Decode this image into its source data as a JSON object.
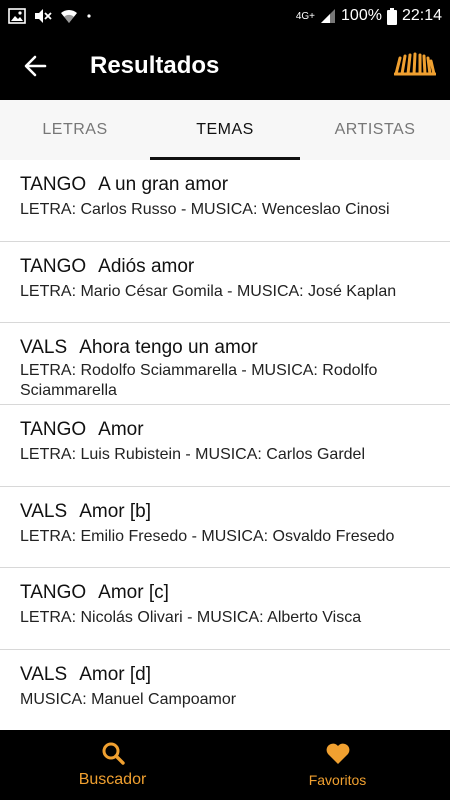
{
  "status_bar": {
    "network": "4G+",
    "battery": "100%",
    "time": "22:14"
  },
  "app_bar": {
    "title": "Resultados",
    "back_icon": "back-arrow-icon",
    "logo_icon": "bandoneon-logo-icon"
  },
  "tabs": [
    {
      "label": "LETRAS",
      "active": false
    },
    {
      "label": "TEMAS",
      "active": true
    },
    {
      "label": "ARTISTAS",
      "active": false
    }
  ],
  "results": [
    {
      "genre": "TANGO",
      "title": "A un gran amor",
      "credits": "LETRA: Carlos Russo - MUSICA: Wenceslao Cinosi"
    },
    {
      "genre": "TANGO",
      "title": "Adiós amor",
      "credits": "LETRA: Mario César Gomila - MUSICA: José Kaplan"
    },
    {
      "genre": "VALS",
      "title": "Ahora tengo un amor",
      "credits": "LETRA: Rodolfo Sciammarella - MUSICA: Rodolfo Sciammarella"
    },
    {
      "genre": "TANGO",
      "title": "Amor",
      "credits": "LETRA: Luis Rubistein - MUSICA: Carlos Gardel"
    },
    {
      "genre": "VALS",
      "title": "Amor [b]",
      "credits": "LETRA: Emilio Fresedo - MUSICA: Osvaldo Fresedo"
    },
    {
      "genre": "TANGO",
      "title": "Amor [c]",
      "credits": "LETRA: Nicolás Olivari - MUSICA: Alberto Visca"
    },
    {
      "genre": "VALS",
      "title": "Amor [d]",
      "credits": "MUSICA: Manuel Campoamor"
    }
  ],
  "bottom_nav": {
    "search_label": "Buscador",
    "favorites_label": "Favoritos",
    "accent_color": "#f0a030"
  }
}
